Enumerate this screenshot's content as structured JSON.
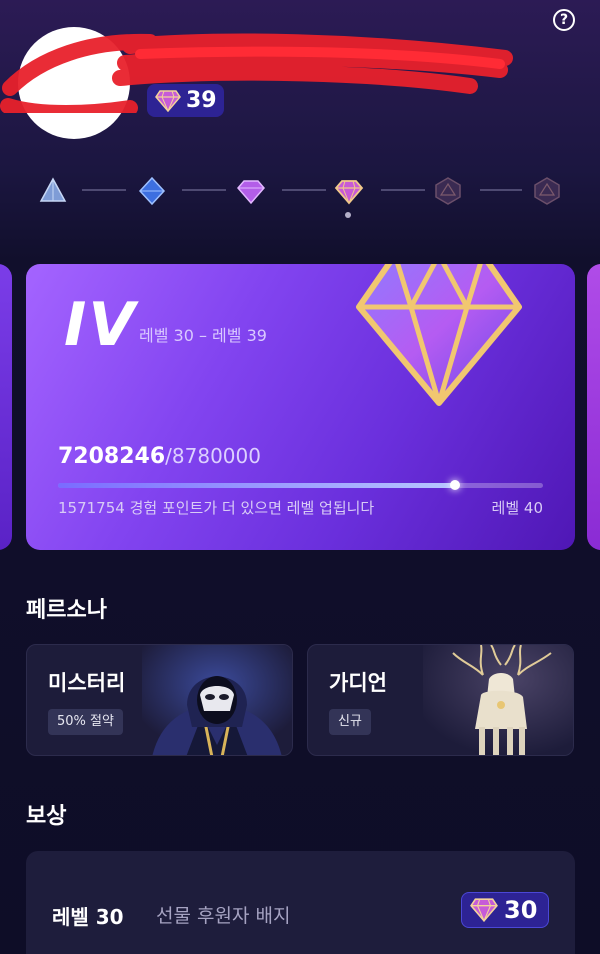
{
  "header": {
    "help_icon_glyph": "?",
    "user_level": "39",
    "level_badge_icon": "diamond-gem-icon"
  },
  "tier_track": {
    "tiers": [
      "bronze-tier-icon",
      "sapphire-tier-icon",
      "amethyst-tier-icon",
      "diamond-tier-icon",
      "locked-tier-icon",
      "locked-tier-icon"
    ],
    "current_index": 3
  },
  "tier_card": {
    "tier_name": "IV",
    "level_range": "레벨 30 – 레벨 39",
    "xp_current": "7208246",
    "xp_total": "/8780000",
    "progress": 0.821,
    "remaining_text": "1571754 경험 포인트가 더 있으면 레벨 업됩니다",
    "next_level": "레벨 40"
  },
  "persona": {
    "title": "페르소나",
    "items": [
      {
        "name": "미스터리",
        "tag": "50% 절약",
        "art": "masked-figure-illustration"
      },
      {
        "name": "가디언",
        "tag": "신규",
        "art": "glowing-stag-illustration"
      }
    ]
  },
  "rewards": {
    "title": "보상",
    "items": [
      {
        "level": "레벨 30",
        "name": "선물 후원자 배지",
        "badge_level": "30"
      }
    ]
  },
  "colors": {
    "accent_badge": "#2d2394",
    "card_gradient_start": "#a464ff",
    "card_gradient_end": "#4f17b5",
    "background": "#0f0d29"
  }
}
